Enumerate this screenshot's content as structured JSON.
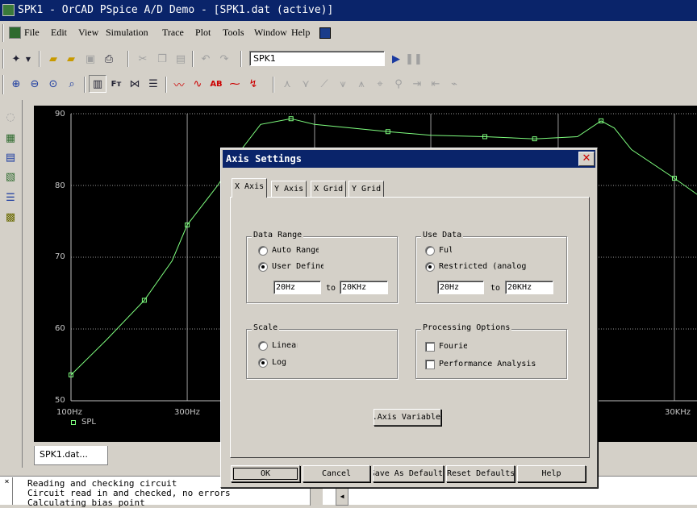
{
  "window": {
    "title": "SPK1 - OrCAD PSpice A/D Demo  - [SPK1.dat (active)]"
  },
  "menu": [
    "File",
    "Edit",
    "View",
    "Simulation",
    "Trace",
    "Plot",
    "Tools",
    "Window",
    "Help"
  ],
  "toolbar": {
    "simulation_profile": "SPK1"
  },
  "plot": {
    "x_ticks": [
      "100Hz",
      "300Hz",
      "30KHz"
    ],
    "y_ticks": [
      "90",
      "80",
      "70",
      "60",
      "50"
    ],
    "legend": "SPL",
    "trace_color": "#7fff7f"
  },
  "chart_data": {
    "type": "line",
    "x_scale": "log",
    "xlim": [
      "100Hz",
      "30KHz"
    ],
    "ylim": [
      50,
      90
    ],
    "grid": true,
    "legend_position": "bottom-left",
    "series": [
      {
        "name": "SPL",
        "x": [
          100,
          140,
          200,
          260,
          300,
          400,
          500,
          600,
          800,
          1000,
          2000,
          3000,
          5000,
          8000,
          12000,
          15000,
          17000,
          20000,
          30000,
          40000
        ],
        "y": [
          53.6,
          58.5,
          64.0,
          69.5,
          74.5,
          80.0,
          85.0,
          88.5,
          89.3,
          88.5,
          87.5,
          87.0,
          86.8,
          86.5,
          86.8,
          89.0,
          88.0,
          85.0,
          81.0,
          78.0
        ]
      }
    ]
  },
  "doc_tab": "SPK1.dat...",
  "output": [
    "Reading and checking circuit",
    "Circuit read in and checked, no errors",
    "Calculating bias point"
  ],
  "dialog": {
    "title": "Axis Settings",
    "tabs": [
      "X Axis",
      "Y Axis",
      "X Grid",
      "Y Grid"
    ],
    "data_range": {
      "label": "Data Range",
      "auto": "Auto Range",
      "user": "User Defined",
      "from": "20Hz",
      "to_label": "to",
      "to": "20KHz"
    },
    "use_data": {
      "label": "Use Data",
      "full": "Full",
      "restricted": "Restricted (analog)",
      "from": "20Hz",
      "to_label": "to",
      "to": "20KHz"
    },
    "scale": {
      "label": "Scale",
      "linear": "Linear",
      "log": "Log"
    },
    "processing": {
      "label": "Processing Options",
      "fourier": "Fourier",
      "performance": "Performance Analysis"
    },
    "axis_variable": "Axis Variable...",
    "buttons": {
      "ok": "OK",
      "cancel": "Cancel",
      "save": "Save As Default",
      "reset": "Reset Defaults",
      "help": "Help"
    }
  }
}
